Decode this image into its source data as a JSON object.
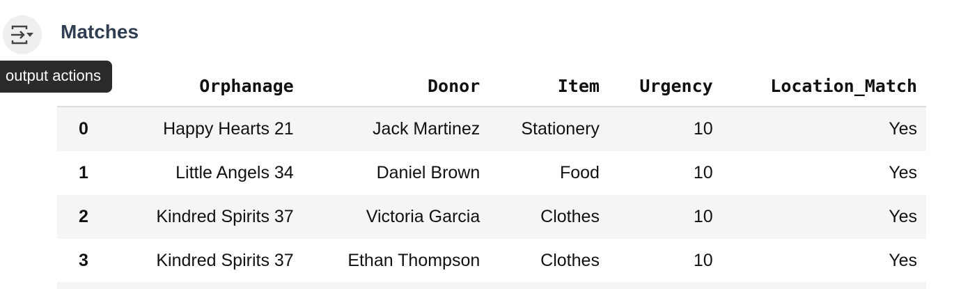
{
  "output": {
    "title": "Matches",
    "tooltip": "output actions"
  },
  "table": {
    "columns": [
      "",
      "Orphanage",
      "Donor",
      "Item",
      "Urgency",
      "Location_Match"
    ],
    "rows": [
      [
        "0",
        "Happy Hearts 21",
        "Jack Martinez",
        "Stationery",
        "10",
        "Yes"
      ],
      [
        "1",
        "Little Angels 34",
        "Daniel Brown",
        "Food",
        "10",
        "Yes"
      ],
      [
        "2",
        "Kindred Spirits 37",
        "Victoria Garcia",
        "Clothes",
        "10",
        "Yes"
      ],
      [
        "3",
        "Kindred Spirits 37",
        "Ethan Thompson",
        "Clothes",
        "10",
        "Yes"
      ]
    ]
  }
}
